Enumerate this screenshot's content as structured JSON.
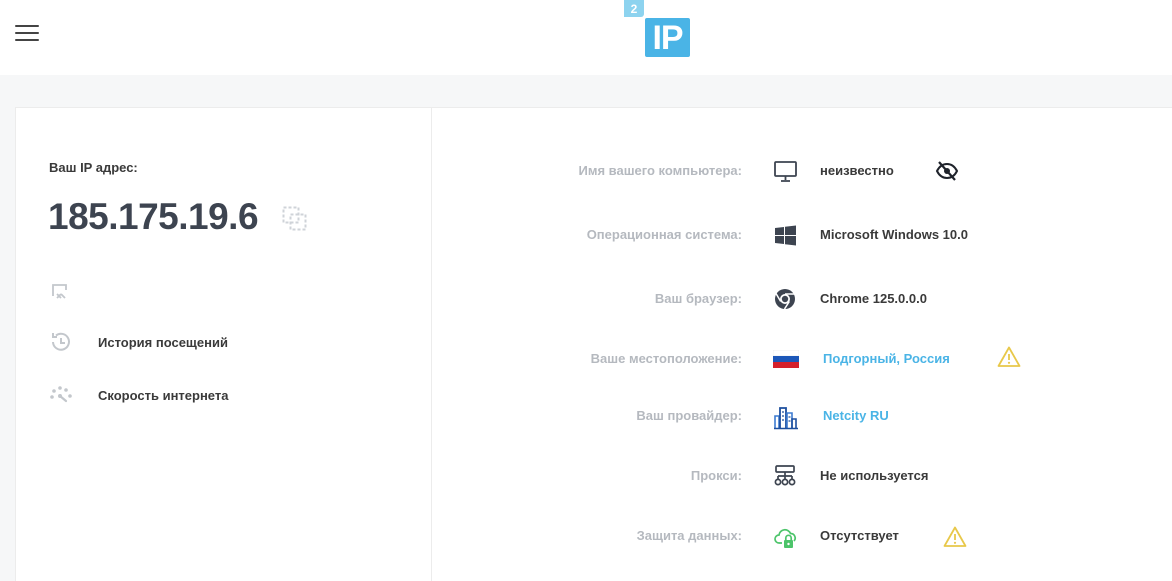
{
  "header": {
    "menu_icon": "hamburger-menu-icon",
    "logo": {
      "badge": "2",
      "text": "IP",
      "badge_color": "#8dd3ef",
      "main_color": "#4ab4e6"
    }
  },
  "left": {
    "ip_label": "Ваш IP адрес:",
    "ip_value": "185.175.19.6",
    "copy_icon": "copy-icon",
    "share_icon": "share-icon",
    "menu": [
      {
        "icon": "history-icon",
        "label": "История посещений"
      },
      {
        "icon": "speedometer-icon",
        "label": "Скорость интернета"
      }
    ]
  },
  "info": [
    {
      "label": "Имя вашего компьютера:",
      "icon": "monitor-icon",
      "value": "неизвестно",
      "extra_icon": "eye-off-icon"
    },
    {
      "label": "Операционная система:",
      "icon": "windows-icon",
      "value": "Microsoft Windows 10.0"
    },
    {
      "label": "Ваш браузер:",
      "icon": "chrome-icon",
      "value": "Chrome 125.0.0.0"
    },
    {
      "label": "Ваше местоположение:",
      "icon": "russia-flag-icon",
      "value": "Подгорный, Россия",
      "extra_icon": "warning-icon"
    },
    {
      "label": "Ваш провайдер:",
      "icon": "provider-building-icon",
      "value": "Netcity RU"
    },
    {
      "label": "Прокси:",
      "icon": "network-icon",
      "value": "Не используется"
    },
    {
      "label": "Защита данных:",
      "icon": "cloud-lock-icon",
      "value": "Отсутствует",
      "extra_icon": "warning-icon"
    }
  ],
  "colors": {
    "accent": "#4ab4e6",
    "warning": "#e8c84a",
    "label_gray": "#b5b9bf",
    "protection_green": "#4cc46a"
  }
}
